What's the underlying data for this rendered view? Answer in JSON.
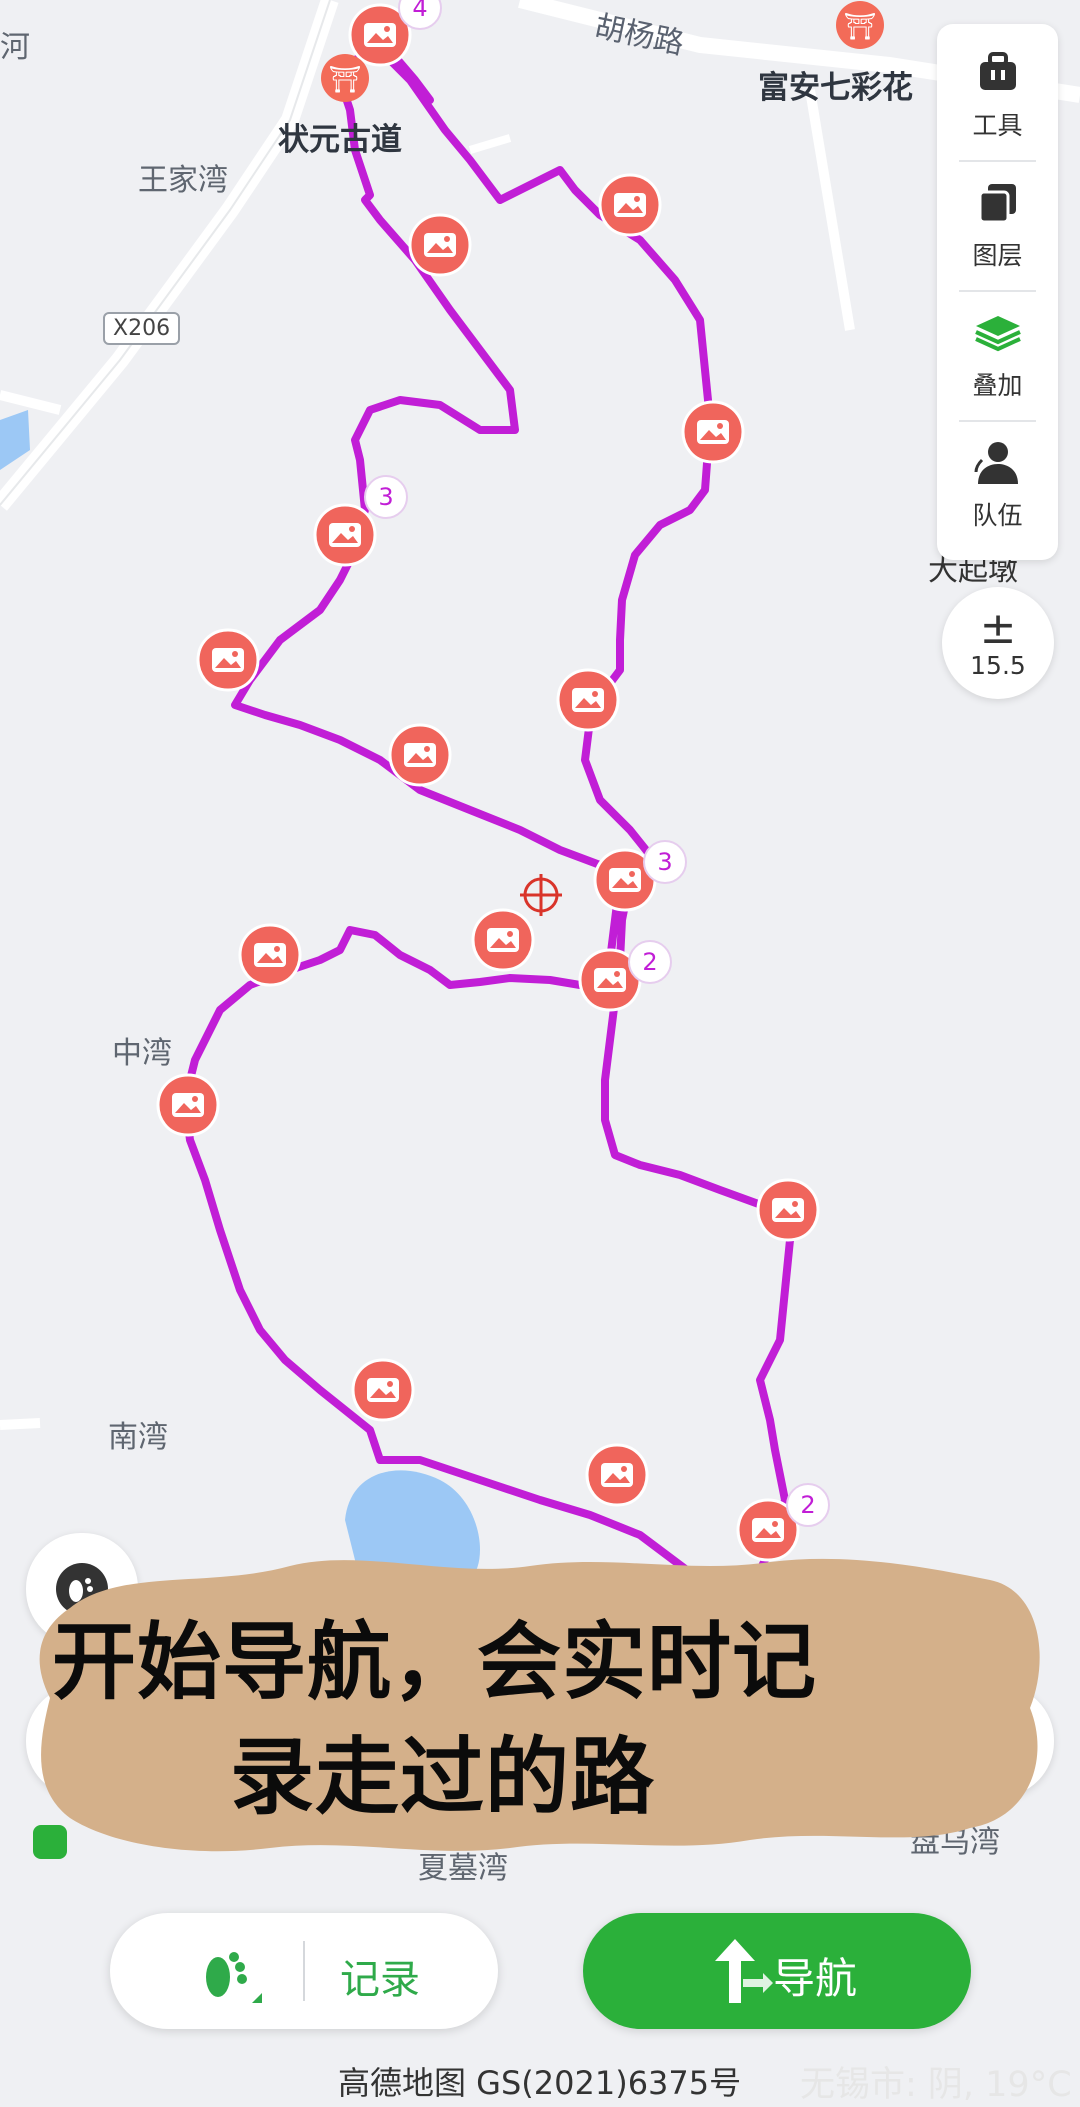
{
  "map": {
    "places": {
      "wangjiawan": "王家湾",
      "zhongwan": "中湾",
      "nanwan": "南湾",
      "xiamuwan": "夏墓湾",
      "panwuwan": "盘乌湾",
      "dashidun": "大起墩",
      "he": "河"
    },
    "pois": {
      "zhuangyuan": "状元古道",
      "fuan": "富安七彩花"
    },
    "roads": {
      "huyang": "胡杨路",
      "x206": "X206"
    },
    "route_numbers": [
      "4",
      "3",
      "3",
      "2",
      "2"
    ],
    "route_color": "#c11ed6"
  },
  "toolbox": {
    "tools": [
      {
        "label": "工具",
        "icon": "toolbox-icon"
      },
      {
        "label": "图层",
        "icon": "layers-icon"
      },
      {
        "label": "叠加",
        "icon": "overlay-stack-icon"
      },
      {
        "label": "队伍",
        "icon": "team-icon"
      }
    ]
  },
  "zoom": {
    "symbol": "±",
    "level": "15.5"
  },
  "caption": {
    "line1": "开始导航，会实时记",
    "line2": "录走过的路"
  },
  "bottom": {
    "record_label": "记录",
    "nav_label": "导航"
  },
  "footer": {
    "attribution": "高德地图 GS(2021)6375号",
    "weather": "无锡市: 阴, 19°C"
  },
  "colors": {
    "accent": "#2bb03a",
    "marker": "#f0655c",
    "banner": "#d4b08a"
  }
}
